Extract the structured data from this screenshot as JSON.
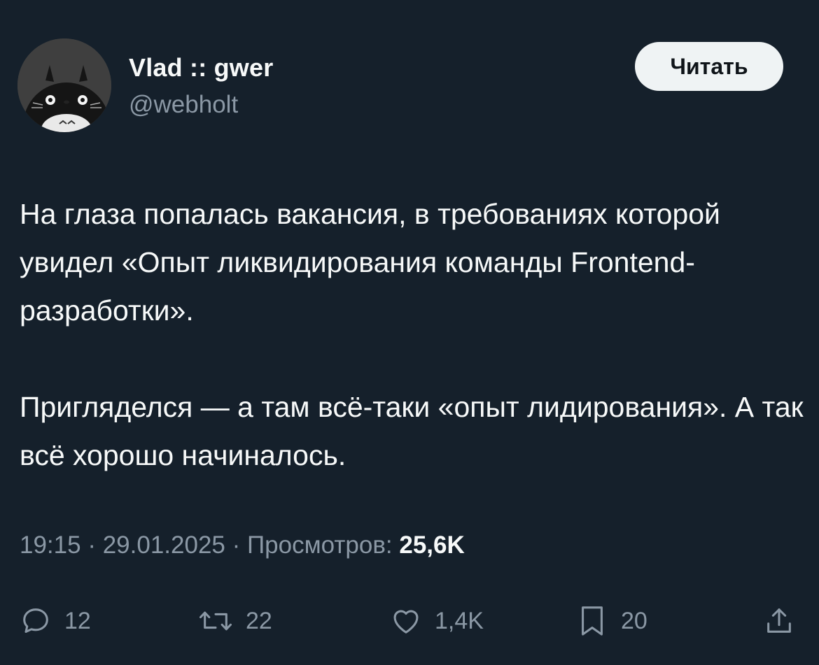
{
  "author": {
    "name": "Vlad :: gwer",
    "handle": "@webholt"
  },
  "follow_button": {
    "label": "Читать"
  },
  "tweet": {
    "paragraphs": [
      "На глаза попалась вакансия, в требованиях которой увидел «Опыт ликвидирования команды Frontend-разработки».",
      "Пригляделся — а там всё-таки «опыт лидирования». А так всё хорошо начиналось."
    ]
  },
  "meta": {
    "time": "19:15",
    "date": "29.01.2025",
    "views_label": "Просмотров:",
    "views_count": "25,6K",
    "separator": "·"
  },
  "actions": {
    "replies": "12",
    "retweets": "22",
    "likes": "1,4K",
    "bookmarks": "20"
  },
  "colors": {
    "background": "#15202b",
    "text": "#f7f9f9",
    "secondary": "#8b98a5",
    "button_bg": "#eff3f4"
  },
  "icons": {
    "reply": "reply-icon",
    "retweet": "retweet-icon",
    "like": "heart-icon",
    "bookmark": "bookmark-icon",
    "share": "share-icon"
  }
}
